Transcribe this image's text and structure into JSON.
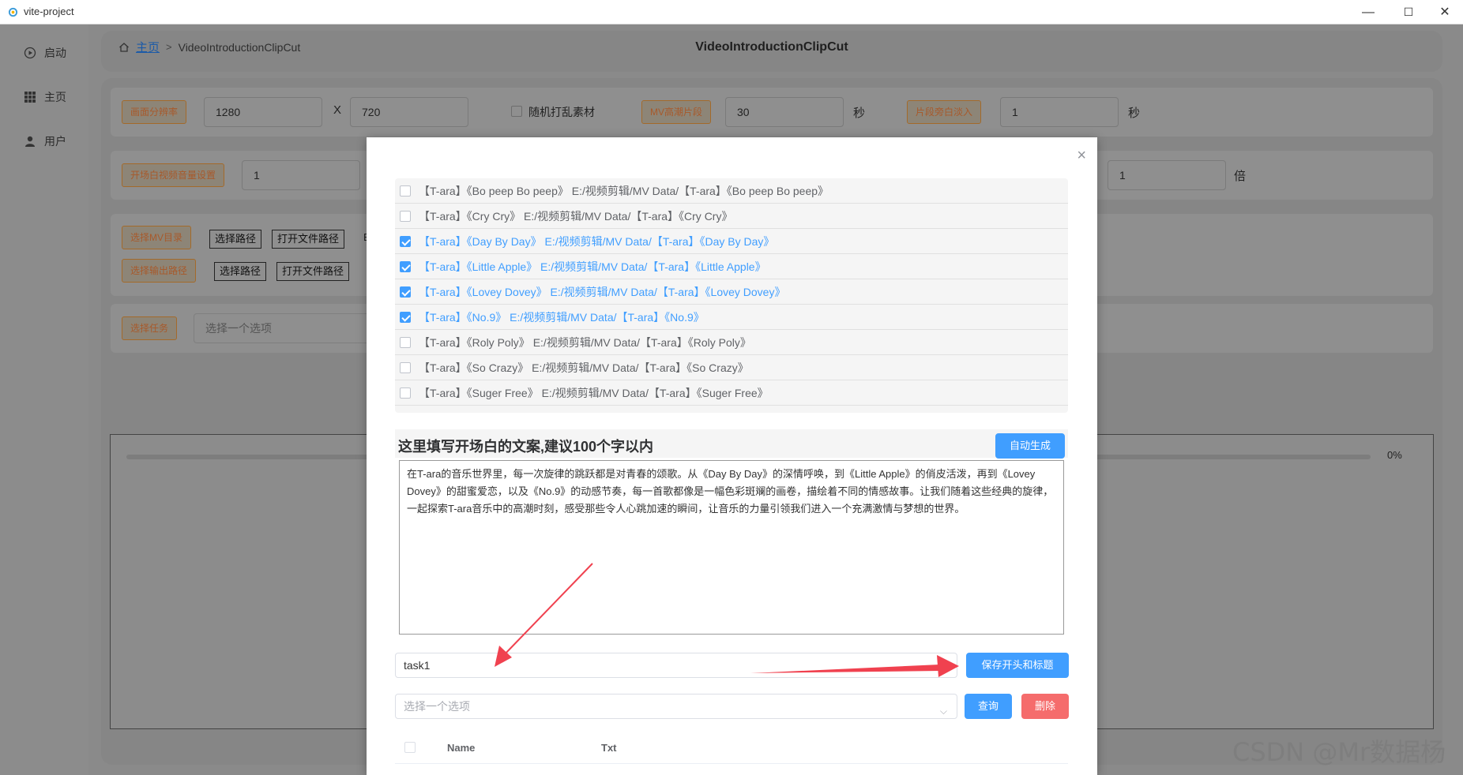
{
  "window": {
    "title": "vite-project",
    "minimize": "—",
    "maximize": "☐",
    "close": "✕"
  },
  "sidebar": {
    "items": [
      {
        "label": "启动",
        "icon": "play-circle-icon"
      },
      {
        "label": "主页",
        "icon": "grid-icon"
      },
      {
        "label": "用户",
        "icon": "user-icon"
      }
    ]
  },
  "header": {
    "breadcrumb_home": "主页",
    "breadcrumb_sep": ">",
    "breadcrumb_current": "VideoIntroductionClipCut",
    "title": "VideoIntroductionClipCut"
  },
  "settings": {
    "resolution_label": "画面分辨率",
    "width": "1280",
    "x_sep": "X",
    "height": "720",
    "shuffle_label": "随机打乱素材",
    "climax_label": "MV高潮片段",
    "climax_value": "30",
    "climax_unit": "秒",
    "fade_label": "片段旁白淡入",
    "fade_value": "1",
    "fade_unit": "秒",
    "volume_label": "开场白视频音量设置",
    "volume_value": "1",
    "ratio_value": "1",
    "ratio_unit": "倍",
    "mv_dir_label": "选择MV目录",
    "choose_path": "选择路径",
    "open_folder": "打开文件路径",
    "mv_dir_trailing": "E",
    "output_label": "选择输出路径",
    "task_label": "选择任务",
    "task_placeholder": "选择一个选项"
  },
  "progress": {
    "percent": "0%",
    "value": 0
  },
  "modal": {
    "close": "×",
    "mv_list": [
      {
        "text": "【T-ara】《Bo peep Bo peep》 E:/视频剪辑/MV Data/【T-ara】《Bo peep Bo peep》",
        "checked": false
      },
      {
        "text": "【T-ara】《Cry Cry》 E:/视频剪辑/MV Data/【T-ara】《Cry Cry》",
        "checked": false
      },
      {
        "text": "【T-ara】《Day By Day》 E:/视频剪辑/MV Data/【T-ara】《Day By Day》",
        "checked": true
      },
      {
        "text": "【T-ara】《Little Apple》 E:/视频剪辑/MV Data/【T-ara】《Little Apple》",
        "checked": true
      },
      {
        "text": "【T-ara】《Lovey Dovey》 E:/视频剪辑/MV Data/【T-ara】《Lovey Dovey》",
        "checked": true
      },
      {
        "text": "【T-ara】《No.9》 E:/视频剪辑/MV Data/【T-ara】《No.9》",
        "checked": true
      },
      {
        "text": "【T-ara】《Roly Poly》 E:/视频剪辑/MV Data/【T-ara】《Roly Poly》",
        "checked": false
      },
      {
        "text": "【T-ara】《So Crazy》 E:/视频剪辑/MV Data/【T-ara】《So Crazy》",
        "checked": false
      },
      {
        "text": "【T-ara】《Suger Free》 E:/视频剪辑/MV Data/【T-ara】《Suger Free》",
        "checked": false
      }
    ],
    "copy_title": "这里填写开场白的文案,建议100个字以内",
    "auto_generate": "自动生成",
    "copy_text": "在T-ara的音乐世界里，每一次旋律的跳跃都是对青春的颂歌。从《Day By Day》的深情呼唤，到《Little Apple》的俏皮活泼，再到《Lovey Dovey》的甜蜜爱恋，以及《No.9》的动感节奏，每一首歌都像是一幅色彩斑斓的画卷，描绘着不同的情感故事。让我们随着这些经典的旋律，一起探索T-ara音乐中的高潮时刻，感受那些令人心跳加速的瞬间，让音乐的力量引领我们进入一个充满激情与梦想的世界。",
    "task_name": "task1",
    "save_button": "保存开头和标题",
    "select_placeholder": "选择一个选项",
    "query_button": "查询",
    "delete_button": "删除",
    "table_columns": [
      "Name",
      "Txt"
    ]
  },
  "watermark": "CSDN @Mr数据杨",
  "colors": {
    "primary": "#409eff",
    "danger": "#f56c6c",
    "annotation_arrow": "#f0414f"
  }
}
